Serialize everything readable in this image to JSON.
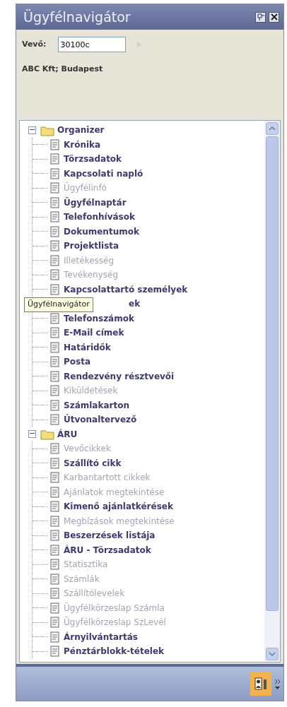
{
  "window": {
    "title": "Ügyfélnavigátor"
  },
  "customer": {
    "label": "Vevő:",
    "value": "30100c",
    "summary": "ABC Kft; Budapest"
  },
  "tree": [
    {
      "label": "Organizer",
      "kind": "folder",
      "expanded": true,
      "children": [
        {
          "label": "Krónika",
          "disabled": false
        },
        {
          "label": "Törzsadatok",
          "disabled": false
        },
        {
          "label": "Kapcsolati napló",
          "disabled": false
        },
        {
          "label": "Ügyfélinfó",
          "disabled": true
        },
        {
          "label": "Ügyfélnaptár",
          "disabled": false
        },
        {
          "label": "Telefonhívások",
          "disabled": false
        },
        {
          "label": "Dokumentumok",
          "disabled": false
        },
        {
          "label": "Projektlista",
          "disabled": false
        },
        {
          "label": "Illetékesség",
          "disabled": true
        },
        {
          "label": "Tevékenység",
          "disabled": true
        },
        {
          "label": "Kapcsolattartó személyek",
          "disabled": false
        },
        {
          "label": "ek",
          "disabled": false,
          "kind": "covered"
        },
        {
          "label": "Telefonszámok",
          "disabled": false
        },
        {
          "label": "E-Mail címek",
          "disabled": false
        },
        {
          "label": "Határidők",
          "disabled": false
        },
        {
          "label": "Posta",
          "disabled": false
        },
        {
          "label": "Rendezvény résztvevői",
          "disabled": false
        },
        {
          "label": "Kiküldetések",
          "disabled": true
        },
        {
          "label": "Számlakarton",
          "disabled": false
        },
        {
          "label": "Útvonaltervező",
          "disabled": false
        }
      ]
    },
    {
      "label": "ÁRU",
      "kind": "folder",
      "expanded": true,
      "children": [
        {
          "label": "Vevőcikkek",
          "disabled": true
        },
        {
          "label": "Szállító cikk",
          "disabled": false
        },
        {
          "label": "Karbantartott cikkek",
          "disabled": true
        },
        {
          "label": "Ajánlatok megtekintése",
          "disabled": true
        },
        {
          "label": "Kimenő ajánlatkérések",
          "disabled": false
        },
        {
          "label": "Megbízások megtekintése",
          "disabled": true
        },
        {
          "label": "Beszerzések listája",
          "disabled": false
        },
        {
          "label": "ÁRU - Törzsadatok",
          "disabled": false
        },
        {
          "label": "Statisztika",
          "disabled": true
        },
        {
          "label": "Számlák",
          "disabled": true
        },
        {
          "label": "Szállítólevelek",
          "disabled": true
        },
        {
          "label": "Ügyfélkörzeslap Számla",
          "disabled": true
        },
        {
          "label": "Ügyfélkörzeslap SzLevél",
          "disabled": true
        },
        {
          "label": "Árnyilvántartás",
          "disabled": false
        },
        {
          "label": "Pénztárblokk-tételek",
          "disabled": false
        }
      ]
    }
  ],
  "tooltip": "Ügyfélnavigátor"
}
